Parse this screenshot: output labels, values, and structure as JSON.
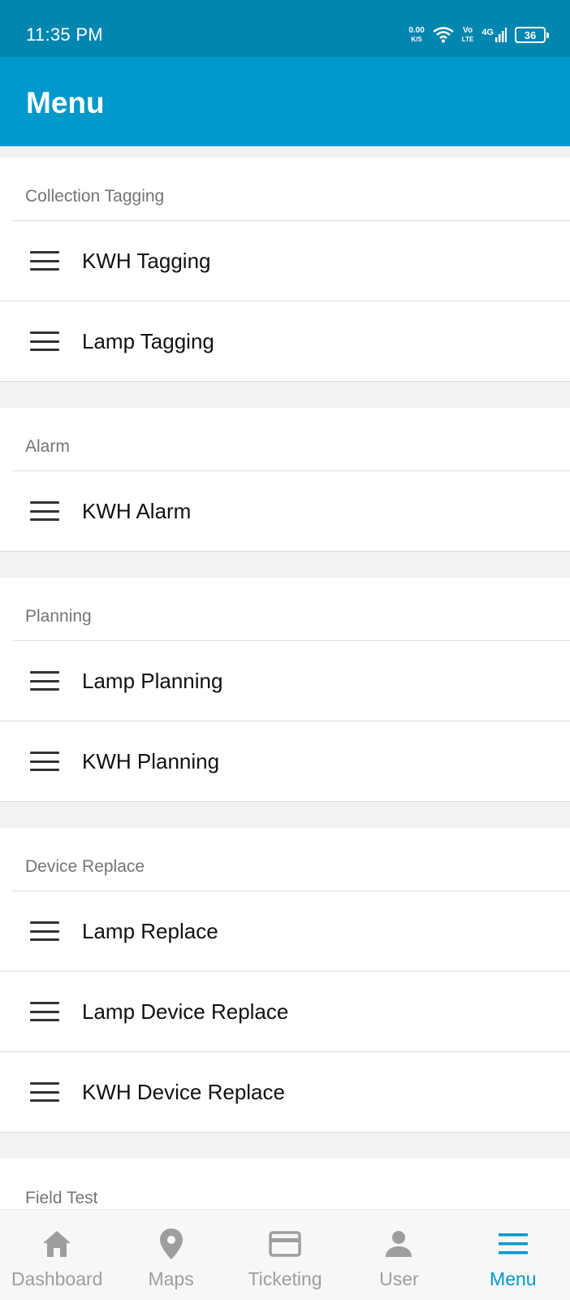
{
  "status": {
    "time": "11:35 PM",
    "netspeed_value": "0.00",
    "netspeed_unit": "K/S",
    "volte_top": "Vo",
    "volte_bottom": "LTE",
    "network": "4G",
    "battery": "36"
  },
  "app_bar": {
    "title": "Menu"
  },
  "sections": [
    {
      "header": "Collection Tagging",
      "items": [
        "KWH Tagging",
        "Lamp Tagging"
      ]
    },
    {
      "header": "Alarm",
      "items": [
        "KWH Alarm"
      ]
    },
    {
      "header": "Planning",
      "items": [
        "Lamp Planning",
        "KWH Planning"
      ]
    },
    {
      "header": "Device Replace",
      "items": [
        "Lamp Replace",
        "Lamp Device Replace",
        "KWH Device Replace"
      ]
    },
    {
      "header": "Field Test",
      "items": []
    }
  ],
  "bottom_nav": {
    "items": [
      {
        "label": "Dashboard",
        "icon": "home-icon"
      },
      {
        "label": "Maps",
        "icon": "map-pin-icon"
      },
      {
        "label": "Ticketing",
        "icon": "card-icon"
      },
      {
        "label": "User",
        "icon": "user-icon"
      },
      {
        "label": "Menu",
        "icon": "menu-icon"
      }
    ],
    "active": "Menu"
  },
  "colors": {
    "status_bar": "#0186b0",
    "app_bar": "#0198cb",
    "active": "#0198cb",
    "inactive": "#9e9e9e"
  }
}
